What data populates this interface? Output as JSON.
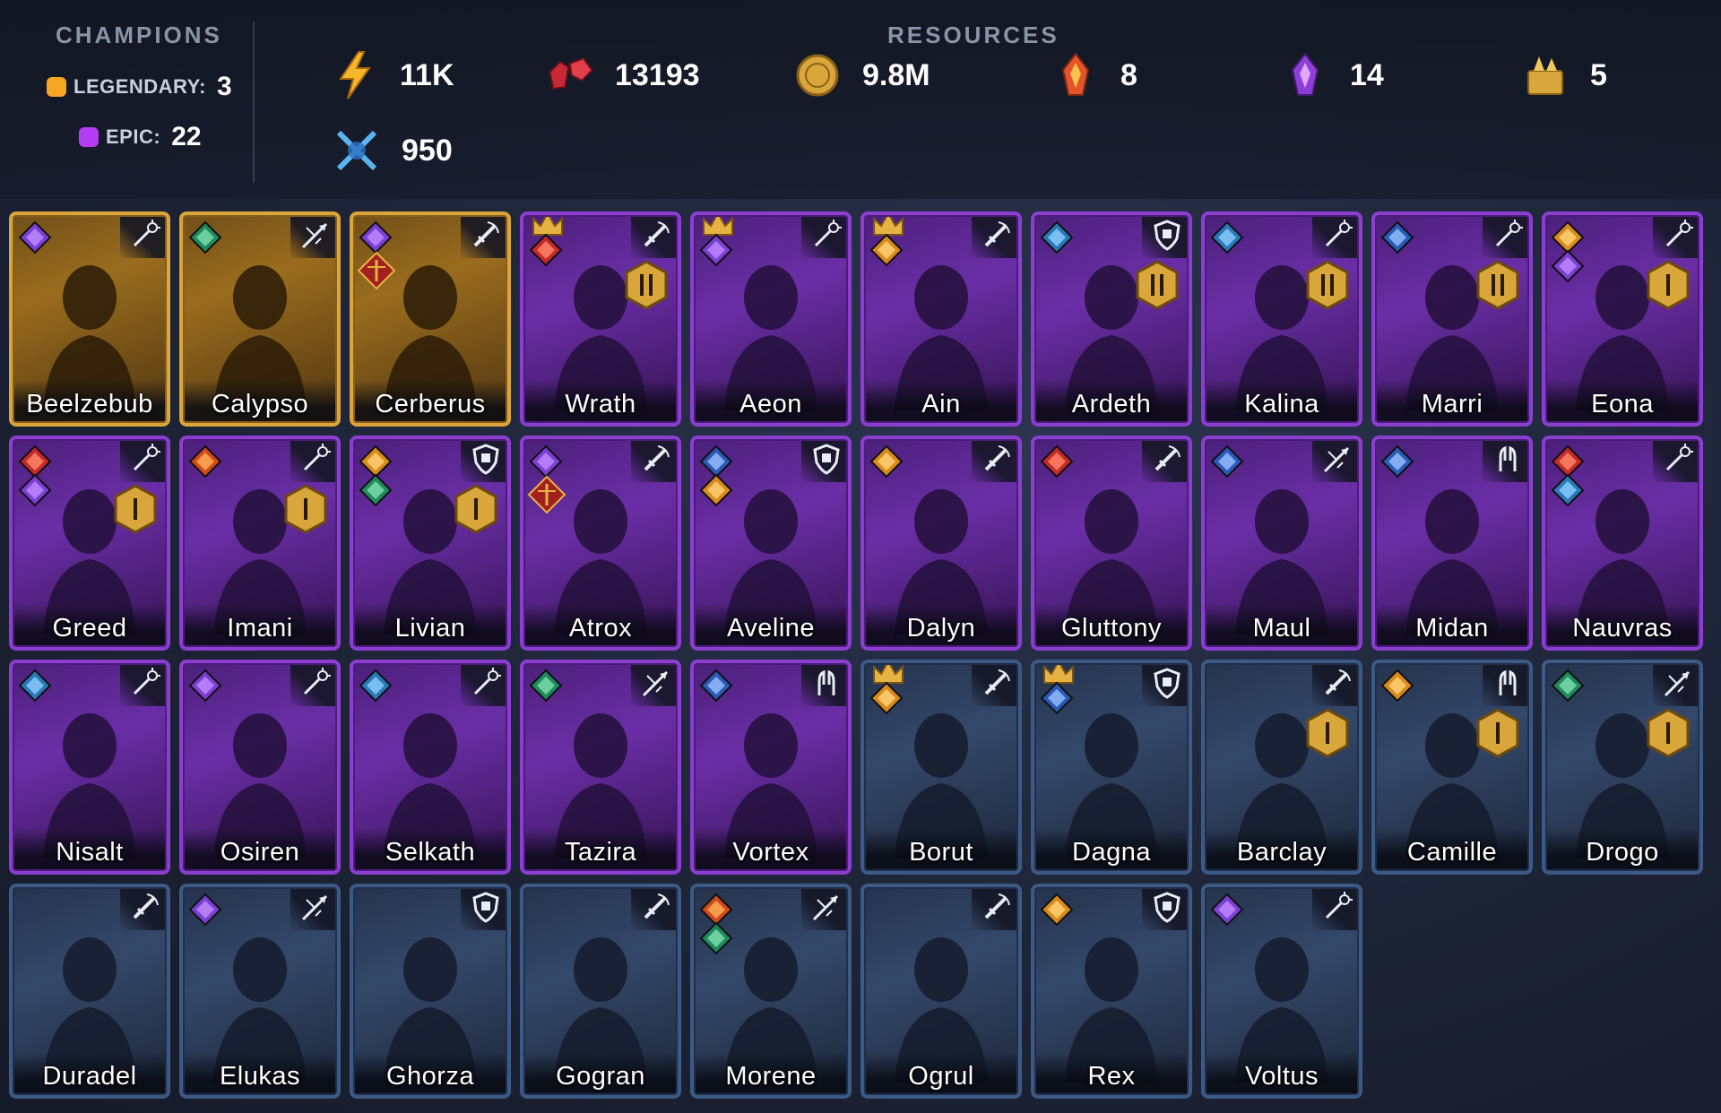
{
  "header": {
    "champions_title": "CHAMPIONS",
    "resources_title": "RESOURCES",
    "legendary": {
      "label": "LEGENDARY:",
      "count": "3",
      "color": "#f5a623"
    },
    "epic": {
      "label": "EPIC:",
      "count": "22",
      "color": "#b43cf2"
    }
  },
  "resources": [
    {
      "icon": "energy-icon",
      "value": "11K"
    },
    {
      "icon": "rubies-icon",
      "value": "13193"
    },
    {
      "icon": "silver-coin-icon",
      "value": "9.8M"
    },
    {
      "icon": "fire-crystal-icon",
      "value": "8"
    },
    {
      "icon": "purple-crystal-icon",
      "value": "14"
    },
    {
      "icon": "gold-trophy-icon",
      "value": "5"
    },
    {
      "icon": "arena-swords-icon",
      "value": "950"
    }
  ],
  "colors": {
    "legendary": "#d9a53c",
    "epic": "#8b3fd0",
    "rare": "#3c5a86"
  },
  "champions": [
    {
      "name": "Beelzebub",
      "rarity": "legendary",
      "affinity": [
        "void"
      ],
      "type": "magic"
    },
    {
      "name": "Calypso",
      "rarity": "legendary",
      "affinity": [
        "spirit"
      ],
      "type": "ranged"
    },
    {
      "name": "Cerberus",
      "rarity": "legendary",
      "affinity": [
        "void"
      ],
      "type": "melee",
      "faction": true
    },
    {
      "name": "Wrath",
      "rarity": "epic",
      "affinity": [
        "force"
      ],
      "type": "melee",
      "crown": true,
      "rank": "II"
    },
    {
      "name": "Aeon",
      "rarity": "epic",
      "affinity": [
        "void"
      ],
      "type": "magic",
      "crown": true
    },
    {
      "name": "Ain",
      "rarity": "epic",
      "affinity": [
        "magic"
      ],
      "type": "melee",
      "crown": true
    },
    {
      "name": "Ardeth",
      "rarity": "epic",
      "affinity": [
        "spirit-blue"
      ],
      "type": "defense",
      "rank": "II"
    },
    {
      "name": "Kalina",
      "rarity": "epic",
      "affinity": [
        "spirit-blue"
      ],
      "type": "magic",
      "rank": "II"
    },
    {
      "name": "Marri",
      "rarity": "epic",
      "affinity": [
        "mind"
      ],
      "type": "magic",
      "rank": "II"
    },
    {
      "name": "Eona",
      "rarity": "epic",
      "affinity": [
        "magic",
        "void"
      ],
      "type": "magic",
      "rank": "I"
    },
    {
      "name": "Greed",
      "rarity": "epic",
      "affinity": [
        "force",
        "void"
      ],
      "type": "magic",
      "rank": "I"
    },
    {
      "name": "Imani",
      "rarity": "epic",
      "affinity": [
        "fire"
      ],
      "type": "magic",
      "rank": "I"
    },
    {
      "name": "Livian",
      "rarity": "epic",
      "affinity": [
        "magic",
        "spirit"
      ],
      "type": "defense",
      "rank": "I"
    },
    {
      "name": "Atrox",
      "rarity": "epic",
      "affinity": [
        "void"
      ],
      "type": "melee",
      "faction": true
    },
    {
      "name": "Aveline",
      "rarity": "epic",
      "affinity": [
        "mind",
        "magic"
      ],
      "type": "defense"
    },
    {
      "name": "Dalyn",
      "rarity": "epic",
      "affinity": [
        "magic"
      ],
      "type": "melee"
    },
    {
      "name": "Gluttony",
      "rarity": "epic",
      "affinity": [
        "force"
      ],
      "type": "melee"
    },
    {
      "name": "Maul",
      "rarity": "epic",
      "affinity": [
        "mind"
      ],
      "type": "ranged"
    },
    {
      "name": "Midan",
      "rarity": "epic",
      "affinity": [
        "mind"
      ],
      "type": "support"
    },
    {
      "name": "Nauvras",
      "rarity": "epic",
      "affinity": [
        "force",
        "spirit-blue"
      ],
      "type": "magic"
    },
    {
      "name": "Nisalt",
      "rarity": "epic",
      "affinity": [
        "spirit-blue"
      ],
      "type": "magic"
    },
    {
      "name": "Osiren",
      "rarity": "epic",
      "affinity": [
        "void"
      ],
      "type": "magic"
    },
    {
      "name": "Selkath",
      "rarity": "epic",
      "affinity": [
        "spirit-blue"
      ],
      "type": "magic"
    },
    {
      "name": "Tazira",
      "rarity": "epic",
      "affinity": [
        "spirit"
      ],
      "type": "ranged"
    },
    {
      "name": "Vortex",
      "rarity": "epic",
      "affinity": [
        "mind"
      ],
      "type": "support"
    },
    {
      "name": "Borut",
      "rarity": "rare",
      "affinity": [
        "magic"
      ],
      "type": "melee",
      "crown": true
    },
    {
      "name": "Dagna",
      "rarity": "rare",
      "affinity": [
        "mind"
      ],
      "type": "defense",
      "crown": true
    },
    {
      "name": "Barclay",
      "rarity": "rare",
      "affinity": [],
      "type": "melee",
      "rank": "I"
    },
    {
      "name": "Camille",
      "rarity": "rare",
      "affinity": [
        "magic"
      ],
      "type": "support",
      "rank": "I"
    },
    {
      "name": "Drogo",
      "rarity": "rare",
      "affinity": [
        "spirit"
      ],
      "type": "ranged",
      "rank": "I"
    },
    {
      "name": "Duradel",
      "rarity": "rare",
      "affinity": [],
      "type": "melee"
    },
    {
      "name": "Elukas",
      "rarity": "rare",
      "affinity": [
        "void"
      ],
      "type": "ranged"
    },
    {
      "name": "Ghorza",
      "rarity": "rare",
      "affinity": [],
      "type": "defense"
    },
    {
      "name": "Gogran",
      "rarity": "rare",
      "affinity": [],
      "type": "melee"
    },
    {
      "name": "Morene",
      "rarity": "rare",
      "affinity": [
        "fire",
        "spirit"
      ],
      "type": "ranged"
    },
    {
      "name": "Ogrul",
      "rarity": "rare",
      "affinity": [],
      "type": "melee"
    },
    {
      "name": "Rex",
      "rarity": "rare",
      "affinity": [
        "magic"
      ],
      "type": "defense"
    },
    {
      "name": "Voltus",
      "rarity": "rare",
      "affinity": [
        "void"
      ],
      "type": "magic"
    }
  ]
}
